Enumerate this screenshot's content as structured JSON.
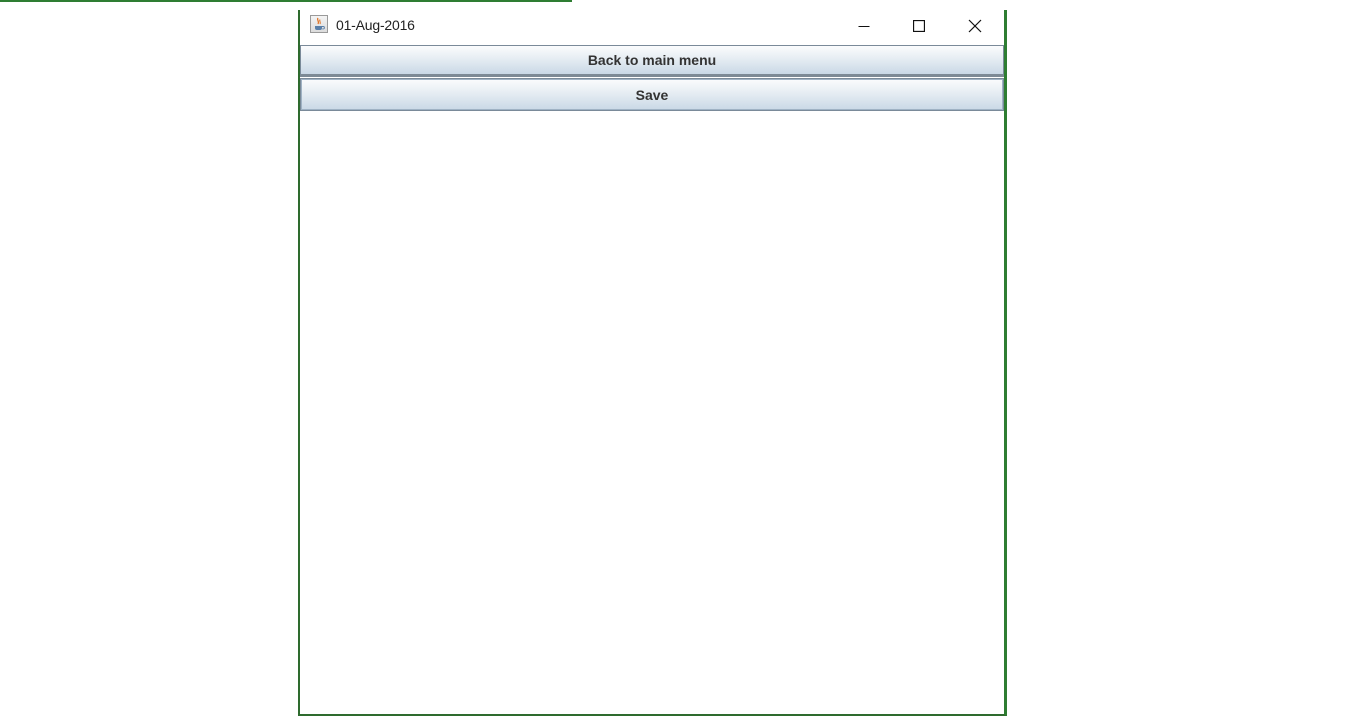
{
  "window": {
    "title": "01-Aug-2016",
    "icon": "java-coffee-cup-icon",
    "controls": {
      "minimize_icon": "minimize-icon",
      "maximize_icon": "maximize-icon",
      "close_icon": "close-icon"
    }
  },
  "buttons": {
    "back_label": "Back to main menu",
    "save_label": "Save"
  },
  "colors": {
    "frame_border": "#2e7d32",
    "button_gradient_top": "#fbfcfd",
    "button_gradient_bottom": "#c9d8e6",
    "button_border": "#7a8a99"
  }
}
